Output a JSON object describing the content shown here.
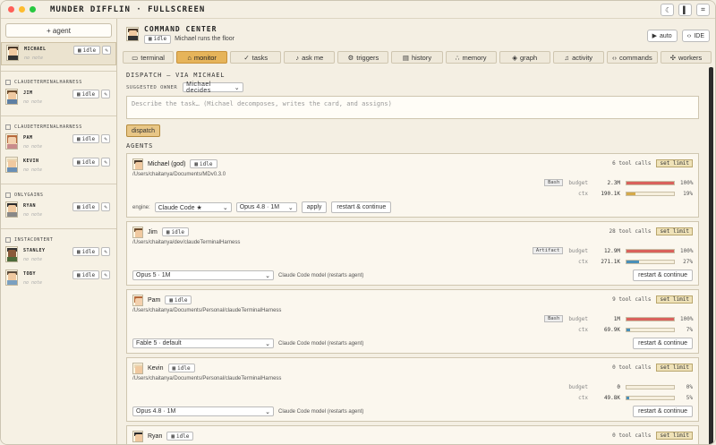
{
  "app": {
    "title": "MUNDER DIFFLIN · FULLSCREEN"
  },
  "sidebar": {
    "add_label": "+ agent",
    "top_agent": {
      "name": "MICHAEL",
      "status": "idle",
      "note": "no note"
    },
    "groups": [
      {
        "name": "CLAUDETERMINALHARNESS",
        "agents": [
          {
            "name": "JIM",
            "status": "idle",
            "note": "no note"
          }
        ]
      },
      {
        "name": "CLAUDETERMINALHARNESS",
        "agents": [
          {
            "name": "PAM",
            "status": "idle",
            "note": "no note"
          },
          {
            "name": "KEVIN",
            "status": "idle",
            "note": "no note"
          }
        ]
      },
      {
        "name": "ONLYGAINS",
        "agents": [
          {
            "name": "RYAN",
            "status": "idle",
            "note": "no note"
          }
        ]
      },
      {
        "name": "INSTACONTENT",
        "agents": [
          {
            "name": "STANLEY",
            "status": "idle",
            "note": "no note"
          },
          {
            "name": "TOBY",
            "status": "idle",
            "note": "no note"
          }
        ]
      }
    ]
  },
  "header": {
    "title": "COMMAND CENTER",
    "status": "idle",
    "subtitle": "Michael runs the floor",
    "auto_label": "auto",
    "ide_label": "IDE"
  },
  "tabs": [
    {
      "label": "terminal",
      "icon": "terminal-icon"
    },
    {
      "label": "monitor",
      "icon": "monitor-icon",
      "active": true
    },
    {
      "label": "tasks",
      "icon": "check-icon"
    },
    {
      "label": "ask me",
      "icon": "bell-icon"
    },
    {
      "label": "triggers",
      "icon": "gear-icon"
    },
    {
      "label": "history",
      "icon": "history-icon"
    },
    {
      "label": "memory",
      "icon": "memory-icon"
    },
    {
      "label": "graph",
      "icon": "graph-icon"
    },
    {
      "label": "activity",
      "icon": "bell-icon"
    },
    {
      "label": "commands",
      "icon": "code-icon"
    },
    {
      "label": "workers",
      "icon": "workers-icon"
    }
  ],
  "dispatch": {
    "title": "DISPATCH — VIA MICHAEL",
    "owner_label": "SUGGESTED OWNER",
    "owner_value": "Michael decides",
    "placeholder": "Describe the task… (Michael decomposes, writes the card, and assigns)",
    "button": "dispatch"
  },
  "agents_title": "AGENTS",
  "agents": [
    {
      "name": "Michael (god)",
      "status": "idle",
      "path": "/Users/chaitanya/Documents/MDv0.3.0",
      "tool_calls": "6 tool calls",
      "set_limit": "set limit",
      "tag": "Bash",
      "budget_label": "budget",
      "budget_value": "2.3M",
      "budget_pct": "100%",
      "budget_frac": 1.0,
      "ctx_label": "ctx",
      "ctx_value": "190.1K",
      "ctx_pct": "19%",
      "ctx_frac": 0.19,
      "ctx_color": "#d4a94a",
      "engine_label": "engine:",
      "engine": "Claude Code ★",
      "model": "Opus 4.8 · 1M",
      "apply": "apply",
      "restart": "restart & continue"
    },
    {
      "name": "Jim",
      "status": "idle",
      "path": "/Users/chaitanya/dev/claudeTerminalHarness",
      "tool_calls": "28 tool calls",
      "set_limit": "set limit",
      "tag": "Artifact",
      "budget_label": "budget",
      "budget_value": "12.9M",
      "budget_pct": "100%",
      "budget_frac": 1.0,
      "ctx_label": "ctx",
      "ctx_value": "271.1K",
      "ctx_pct": "27%",
      "ctx_frac": 0.27,
      "ctx_color": "#4a8fb8",
      "model": "Opus 5 · 1M",
      "hint": "Claude Code model (restarts agent)",
      "restart": "restart & continue"
    },
    {
      "name": "Pam",
      "status": "idle",
      "path": "/Users/chaitanya/Documents/Personal/claudeTerminalHarness",
      "tool_calls": "9 tool calls",
      "set_limit": "set limit",
      "tag": "Bash",
      "budget_label": "budget",
      "budget_value": "1M",
      "budget_pct": "100%",
      "budget_frac": 1.0,
      "ctx_label": "ctx",
      "ctx_value": "69.9K",
      "ctx_pct": "7%",
      "ctx_frac": 0.07,
      "ctx_color": "#4a8fb8",
      "model": "Fable 5 · default",
      "hint": "Claude Code model (restarts agent)",
      "restart": "restart & continue"
    },
    {
      "name": "Kevin",
      "status": "idle",
      "path": "/Users/chaitanya/Documents/Personal/claudeTerminalHarness",
      "tool_calls": "0 tool calls",
      "set_limit": "set limit",
      "tag": "",
      "budget_label": "budget",
      "budget_value": "0",
      "budget_pct": "0%",
      "budget_frac": 0.0,
      "ctx_label": "ctx",
      "ctx_value": "49.8K",
      "ctx_pct": "5%",
      "ctx_frac": 0.05,
      "ctx_color": "#4a8fb8",
      "model": "Opus 4.8 · 1M",
      "hint": "Claude Code model (restarts agent)",
      "restart": "restart & continue"
    },
    {
      "name": "Ryan",
      "status": "idle",
      "tool_calls": "0 tool calls",
      "set_limit": "set limit"
    }
  ],
  "colors": {
    "accent": "#e6b45a",
    "budget": "#d9615c",
    "ctx_blue": "#4a8fb8",
    "ctx_gold": "#d4a94a",
    "close": "#ff5f57",
    "min": "#febc2e",
    "max": "#28c840"
  }
}
